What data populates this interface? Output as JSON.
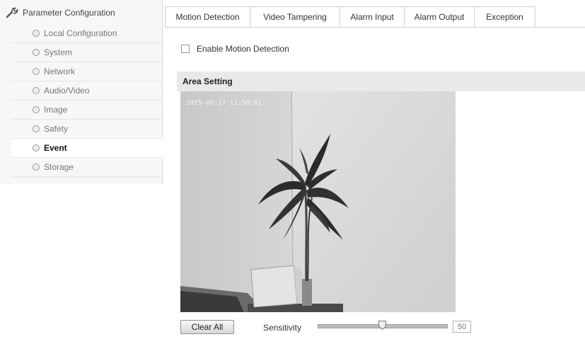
{
  "sidebar": {
    "header": "Parameter Configuration",
    "items": [
      {
        "label": "Local Configuration"
      },
      {
        "label": "System"
      },
      {
        "label": "Network"
      },
      {
        "label": "Audio/Video"
      },
      {
        "label": "Image"
      },
      {
        "label": "Safety"
      },
      {
        "label": "Event"
      },
      {
        "label": "Storage"
      }
    ],
    "active": "Event"
  },
  "tabs": [
    {
      "label": "Motion Detection"
    },
    {
      "label": "Video Tampering"
    },
    {
      "label": "Alarm Input"
    },
    {
      "label": "Alarm Output"
    },
    {
      "label": "Exception"
    }
  ],
  "active_tab": "Motion Detection",
  "motion": {
    "enable_label": "Enable Motion Detection",
    "enabled": false,
    "area_setting_title": "Area Setting",
    "video_timestamp": "2015-08-17 11:50:01",
    "clear_all_label": "Clear All",
    "sensitivity_label": "Sensitivity",
    "sensitivity_value": "50",
    "sensitivity_fraction": 0.5
  }
}
